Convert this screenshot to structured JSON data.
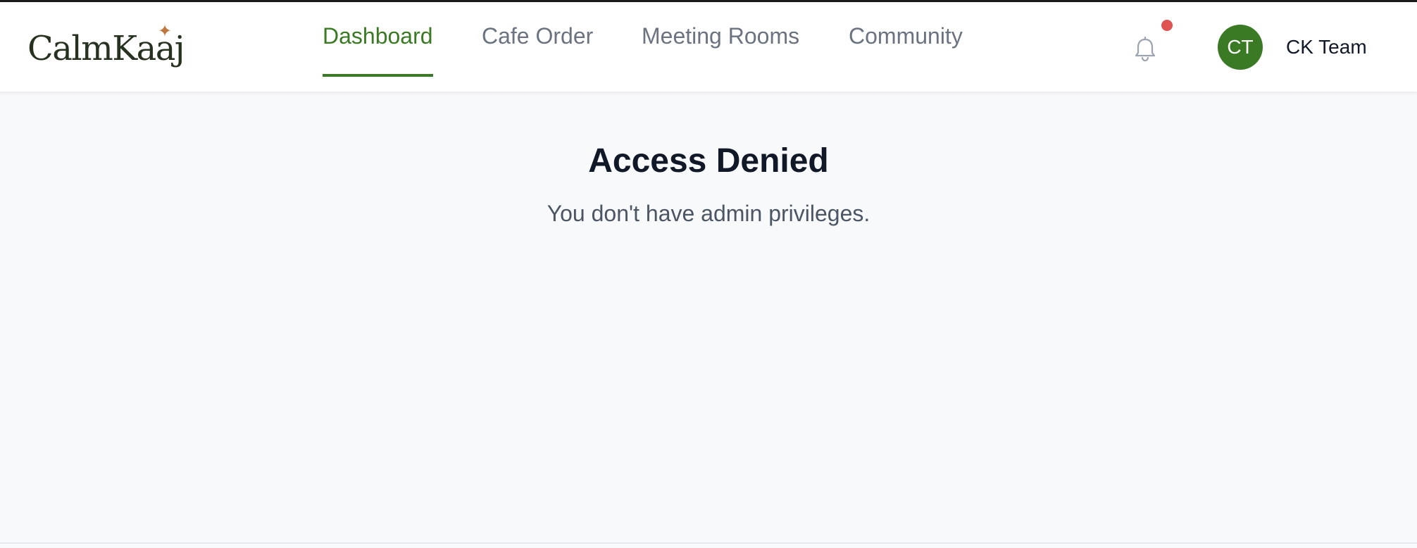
{
  "header": {
    "logo": "CalmKaaj",
    "nav": [
      {
        "label": "Dashboard",
        "active": true
      },
      {
        "label": "Cafe Order",
        "active": false
      },
      {
        "label": "Meeting Rooms",
        "active": false
      },
      {
        "label": "Community",
        "active": false
      }
    ],
    "user": {
      "initials": "CT",
      "name": "CK Team"
    }
  },
  "main": {
    "title": "Access Denied",
    "message": "You don't have admin privileges."
  },
  "colors": {
    "accent": "#3a7a24",
    "notification": "#e05353",
    "logo_star": "#c0773d"
  }
}
